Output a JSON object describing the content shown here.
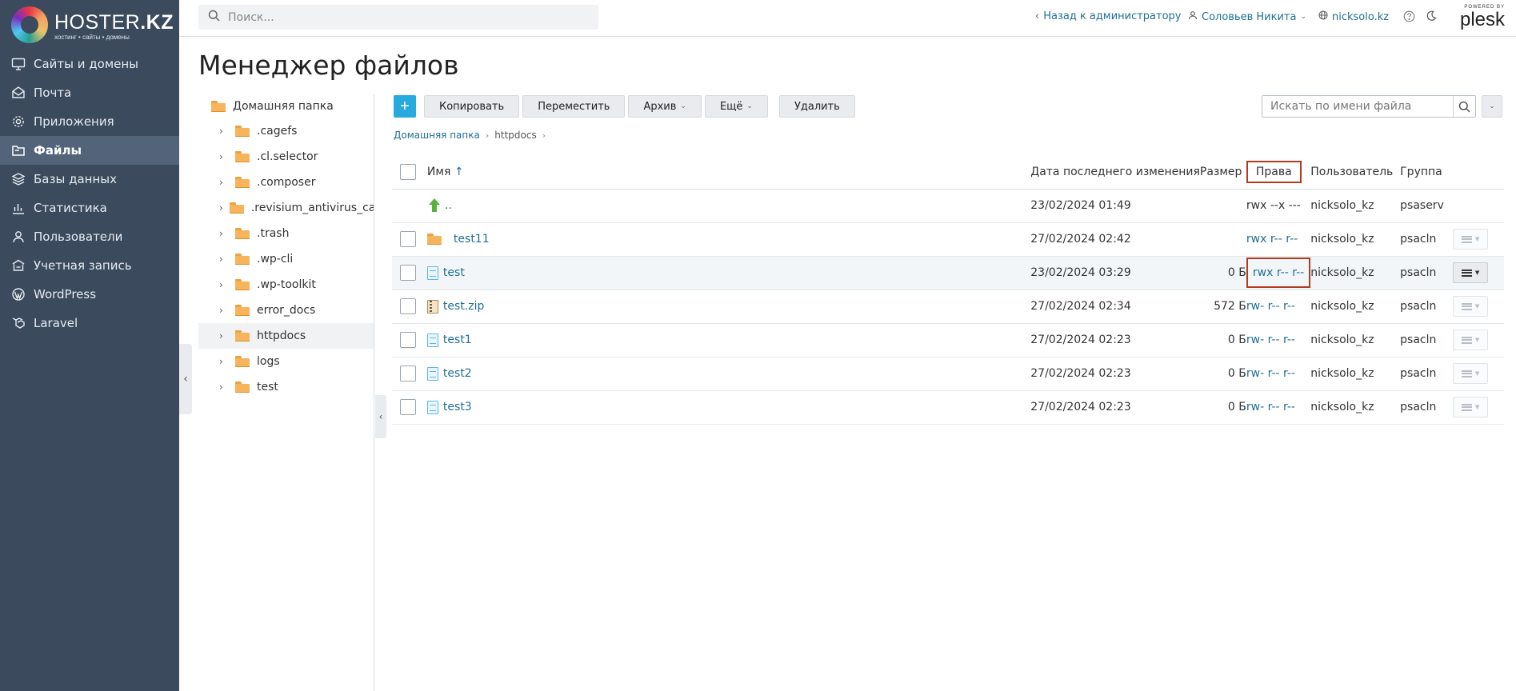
{
  "logo": {
    "brand": "HOSTER",
    "brand_suffix": ".KZ",
    "tagline": "хостинг • сайты • домены"
  },
  "sidebar": {
    "items": [
      {
        "label": "Сайты и домены",
        "icon": "monitor-icon"
      },
      {
        "label": "Почта",
        "icon": "mail-icon"
      },
      {
        "label": "Приложения",
        "icon": "gear-icon"
      },
      {
        "label": "Файлы",
        "icon": "folder-icon",
        "active": true
      },
      {
        "label": "Базы данных",
        "icon": "database-icon"
      },
      {
        "label": "Статистика",
        "icon": "chart-icon"
      },
      {
        "label": "Пользователи",
        "icon": "user-icon"
      },
      {
        "label": "Учетная запись",
        "icon": "account-icon"
      },
      {
        "label": "WordPress",
        "icon": "wordpress-icon"
      },
      {
        "label": "Laravel",
        "icon": "laravel-icon"
      }
    ]
  },
  "header": {
    "search_placeholder": "Поиск...",
    "back_to_admin": "Назад к администратору",
    "user_name": "Соловьев Никита",
    "domain": "nicksolo.kz",
    "powered_by": "POWERED BY",
    "plesk": "plesk"
  },
  "main": {
    "title": "Менеджер файлов",
    "toolbar": {
      "add": "+",
      "copy": "Копировать",
      "move": "Переместить",
      "archive": "Архив",
      "more": "Ещё",
      "delete": "Удалить"
    },
    "filter_placeholder": "Искать по имени файла",
    "breadcrumb": {
      "home": "Домашняя папка",
      "current": "httpdocs"
    }
  },
  "tree": {
    "root": "Домашняя папка",
    "items": [
      ".cagefs",
      ".cl.selector",
      ".composer",
      ".revisium_antivirus_cache",
      ".trash",
      ".wp-cli",
      ".wp-toolkit",
      "error_docs",
      "httpdocs",
      "logs",
      "test"
    ],
    "selected": "httpdocs"
  },
  "table": {
    "columns": {
      "name": "Имя",
      "sort_arrow": "↑",
      "modified": "Дата последнего изменения",
      "size": "Размер",
      "perms": "Права",
      "user": "Пользователь",
      "group": "Группа"
    },
    "rows": [
      {
        "name": "..",
        "modified": "23/02/2024 01:49",
        "size": "",
        "perms": "rwx --x ---",
        "user": "nicksolo_kz",
        "group": "psaserv"
      },
      {
        "name": "test11",
        "modified": "27/02/2024 02:42",
        "size": "",
        "perms": "rwx r-- r--",
        "user": "nicksolo_kz",
        "group": "psacln"
      },
      {
        "name": "test",
        "modified": "23/02/2024 03:29",
        "size": "0 Б",
        "perms": "rwx r-- r--",
        "user": "nicksolo_kz",
        "group": "psacln"
      },
      {
        "name": "test.zip",
        "modified": "27/02/2024 02:34",
        "size": "572 Б",
        "perms": "rw- r-- r--",
        "user": "nicksolo_kz",
        "group": "psacln"
      },
      {
        "name": "test1",
        "modified": "27/02/2024 02:23",
        "size": "0 Б",
        "perms": "rw- r-- r--",
        "user": "nicksolo_kz",
        "group": "psacln"
      },
      {
        "name": "test2",
        "modified": "27/02/2024 02:23",
        "size": "0 Б",
        "perms": "rw- r-- r--",
        "user": "nicksolo_kz",
        "group": "psacln"
      },
      {
        "name": "test3",
        "modified": "27/02/2024 02:23",
        "size": "0 Б",
        "perms": "rw- r-- r--",
        "user": "nicksolo_kz",
        "group": "psacln"
      }
    ]
  },
  "colors": {
    "sidebar_bg": "#3b4a5c",
    "sidebar_active": "#52637a",
    "link": "#1f6f94",
    "accent_button": "#28aade",
    "highlight_border": "#b23a1e"
  }
}
